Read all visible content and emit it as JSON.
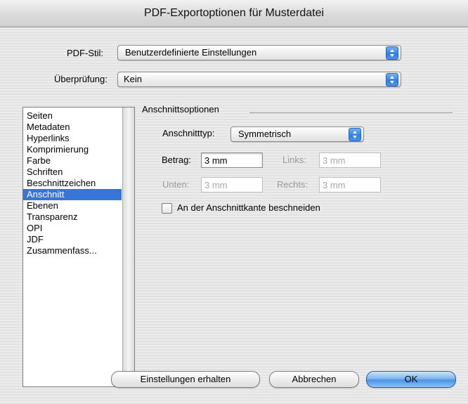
{
  "window": {
    "title": "PDF-Exportoptionen für Musterdatei"
  },
  "pdf_stil": {
    "label": "PDF-Stil:",
    "value": "Benutzerdefinierte Einstellungen"
  },
  "ueberpruefung": {
    "label": "Überprüfung:",
    "value": "Kein"
  },
  "sidebar": {
    "items": [
      {
        "label": "Seiten"
      },
      {
        "label": "Metadaten"
      },
      {
        "label": "Hyperlinks"
      },
      {
        "label": "Komprimierung"
      },
      {
        "label": "Farbe"
      },
      {
        "label": "Schriften"
      },
      {
        "label": "Beschnittzeichen"
      },
      {
        "label": "Anschnitt",
        "selected": true
      },
      {
        "label": "Ebenen"
      },
      {
        "label": "Transparenz"
      },
      {
        "label": "OPI"
      },
      {
        "label": "JDF"
      },
      {
        "label": "Zusammenfass..."
      }
    ]
  },
  "anschnitt": {
    "group_title": "Anschnittsoptionen",
    "typ_label": "Anschnitttyp:",
    "typ_value": "Symmetrisch",
    "betrag_label": "Betrag:",
    "betrag_value": "3 mm",
    "links_label": "Links:",
    "links_value": "3 mm",
    "unten_label": "Unten:",
    "unten_value": "3 mm",
    "rechts_label": "Rechts:",
    "rechts_value": "3 mm",
    "clip_label": "An der Anschnittkante beschneiden",
    "clip_checked": false
  },
  "buttons": {
    "save": "Einstellungen erhalten",
    "cancel": "Abbrechen",
    "ok": "OK"
  },
  "colors": {
    "selection": "#3875d7",
    "accent": "#4a93e6"
  }
}
